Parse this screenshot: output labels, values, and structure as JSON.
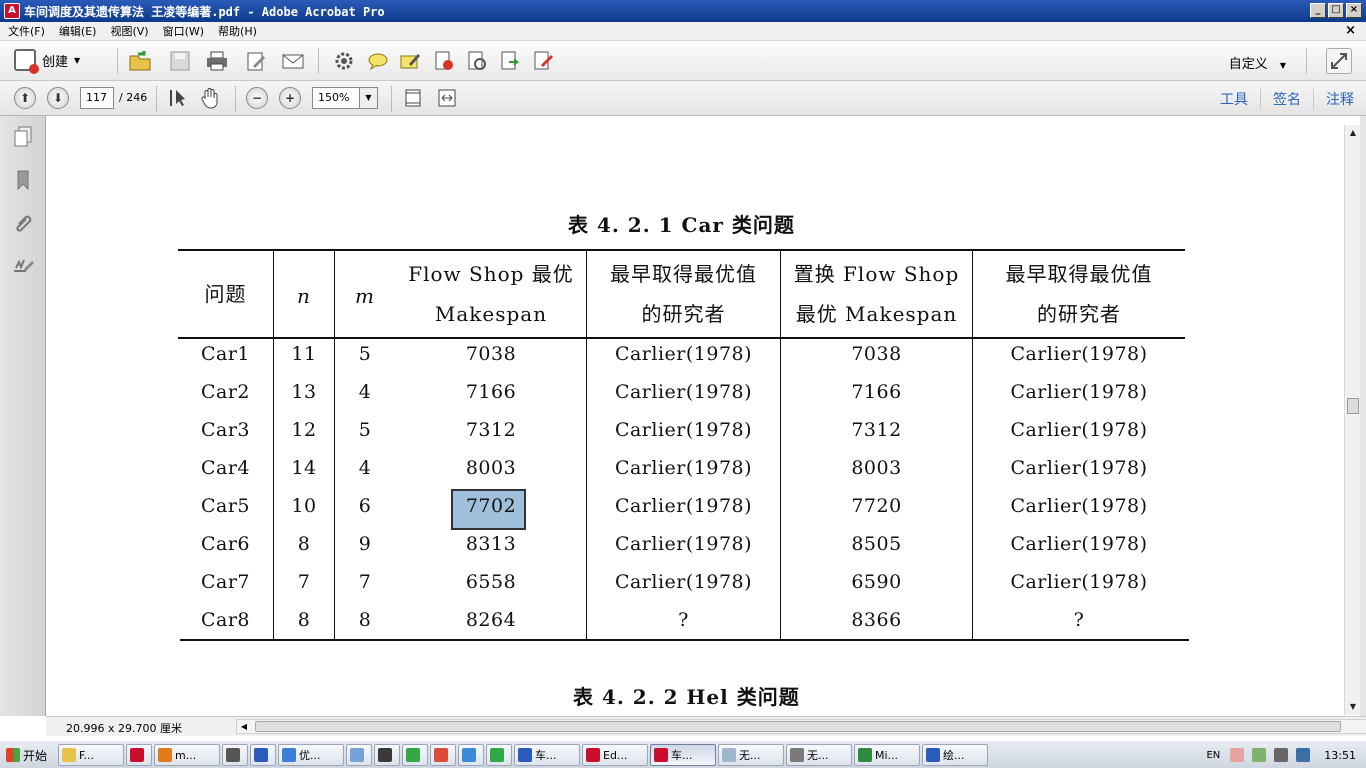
{
  "window": {
    "title": "车间调度及其遗传算法 王凌等编著.pdf - Adobe Acrobat Pro",
    "controls": [
      "_",
      "□",
      "×"
    ]
  },
  "menu": {
    "items": [
      "文件(F)",
      "编辑(E)",
      "视图(V)",
      "窗口(W)",
      "帮助(H)"
    ],
    "close": "×"
  },
  "toolbar": {
    "create_label": "创建",
    "customize_label": "自定义"
  },
  "nav": {
    "page_current": "117",
    "page_total": "/ 246",
    "zoom": "150%",
    "right_links": [
      "工具",
      "签名",
      "注释"
    ]
  },
  "document": {
    "caption1": "表 4. 2. 1    Car 类问题",
    "caption2": "表 4. 2. 2    Hel 类问题",
    "table": {
      "headers": [
        "问题",
        "n",
        "m",
        [
          "Flow Shop 最优",
          "Makespan"
        ],
        [
          "最早取得最优值",
          "的研究者"
        ],
        [
          "置换 Flow Shop",
          "最优 Makespan"
        ],
        [
          "最早取得最优值",
          "的研究者"
        ]
      ],
      "rows": [
        [
          "Car1",
          "11",
          "5",
          "7038",
          "Carlier(1978)",
          "7038",
          "Carlier(1978)"
        ],
        [
          "Car2",
          "13",
          "4",
          "7166",
          "Carlier(1978)",
          "7166",
          "Carlier(1978)"
        ],
        [
          "Car3",
          "12",
          "5",
          "7312",
          "Carlier(1978)",
          "7312",
          "Carlier(1978)"
        ],
        [
          "Car4",
          "14",
          "4",
          "8003",
          "Carlier(1978)",
          "8003",
          "Carlier(1978)"
        ],
        [
          "Car5",
          "10",
          "6",
          "7702",
          "Carlier(1978)",
          "7720",
          "Carlier(1978)"
        ],
        [
          "Car6",
          "8",
          "9",
          "8313",
          "Carlier(1978)",
          "8505",
          "Carlier(1978)"
        ],
        [
          "Car7",
          "7",
          "7",
          "6558",
          "Carlier(1978)",
          "6590",
          "Carlier(1978)"
        ],
        [
          "Car8",
          "8",
          "8",
          "8264",
          "?",
          "8366",
          "?"
        ]
      ]
    }
  },
  "status": {
    "page_size": "20.996 x 29.700 厘米"
  },
  "taskbar": {
    "start": "开始",
    "items": [
      "F...",
      "",
      "m...",
      "",
      "",
      "优...",
      "",
      "",
      "",
      "",
      "",
      "",
      "车...",
      "Ed...",
      "车...",
      "无...",
      "无...",
      "Mi...",
      "绘..."
    ],
    "lang": "EN",
    "clock": "13:51"
  }
}
